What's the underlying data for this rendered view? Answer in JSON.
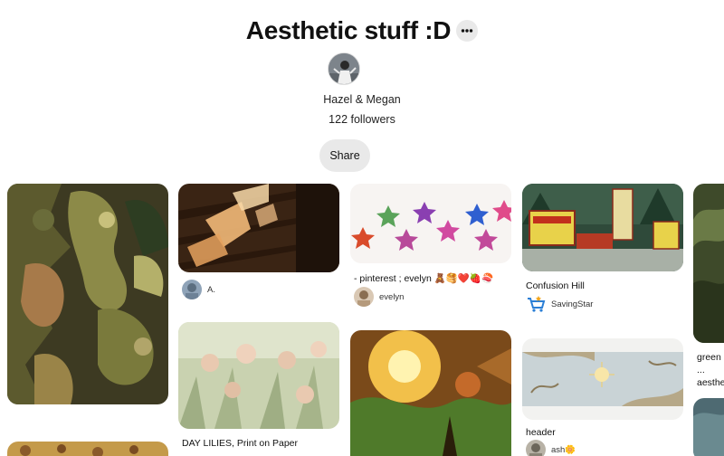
{
  "board": {
    "title": "Aesthetic stuff :D",
    "owners": "Hazel & Megan",
    "followers": "122 followers",
    "share_label": "Share",
    "more_icon": "ellipsis-icon"
  },
  "pins": [
    {
      "title": "",
      "user": ""
    },
    {
      "title": "",
      "user": "A."
    },
    {
      "title": "DAY LILIES, Print on Paper",
      "user": ""
    },
    {
      "title": "- pinterest ; evelyn 🧸🥞❤️🍓🍣",
      "user": "evelyn"
    },
    {
      "title": "",
      "user": ""
    },
    {
      "title": "Confusion Hill",
      "user": "SavingStar"
    },
    {
      "title": "header",
      "user": "ash🌼"
    },
    {
      "title": "green ... aesthe...",
      "user": ""
    }
  ],
  "colors": {
    "button_bg": "#e9e9e9",
    "text": "#111111",
    "savingstar_icon": "#2b7fd6"
  }
}
